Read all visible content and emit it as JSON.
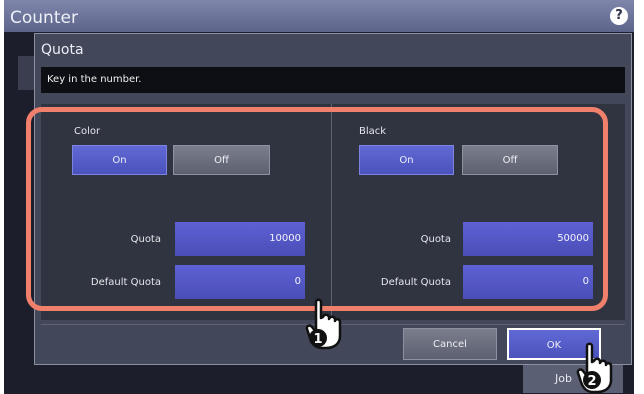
{
  "window": {
    "title": "Counter",
    "help_icon": "question-mark-icon",
    "help_glyph": "?"
  },
  "background": {
    "job_label": "Job"
  },
  "dialog": {
    "title": "Quota",
    "message": "Key in the number.",
    "color": {
      "label": "Color",
      "on_label": "On",
      "off_label": "Off",
      "selected": "On",
      "quota_label": "Quota",
      "quota_value": "10000",
      "default_label": "Default Quota",
      "default_value": "0"
    },
    "black": {
      "label": "Black",
      "on_label": "On",
      "off_label": "Off",
      "selected": "On",
      "quota_label": "Quota",
      "quota_value": "50000",
      "default_label": "Default Quota",
      "default_value": "0"
    },
    "cancel_label": "Cancel",
    "ok_label": "OK"
  },
  "callouts": [
    {
      "number": "1",
      "icon": "pointing-hand-icon"
    },
    {
      "number": "2",
      "icon": "pointing-hand-icon"
    }
  ],
  "colors": {
    "highlight": "#f0806c",
    "on_button": "#5860c8",
    "field": "#5458c8"
  }
}
